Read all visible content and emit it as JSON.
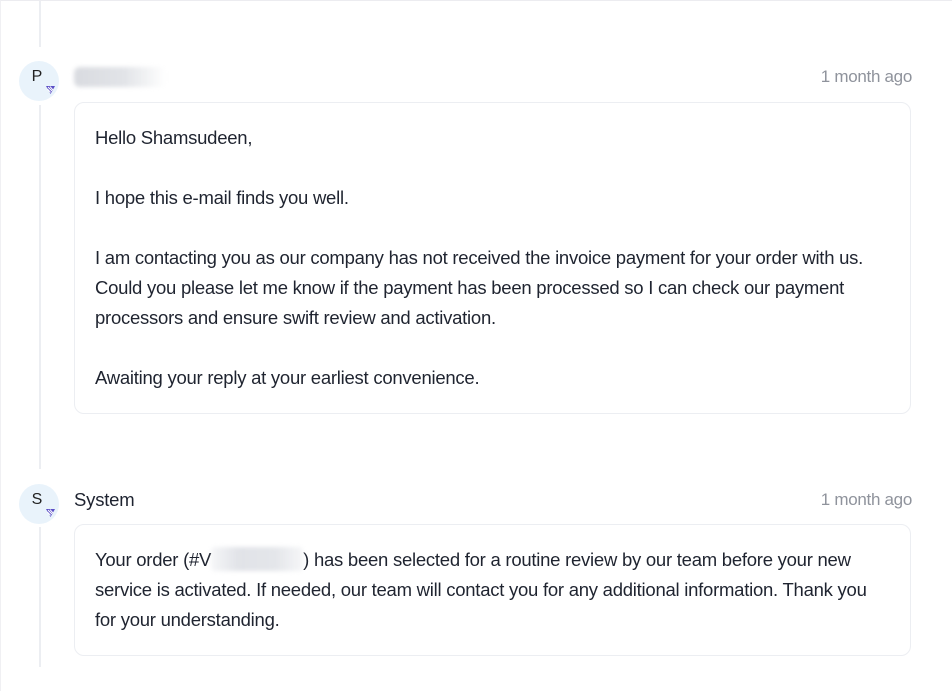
{
  "messages": [
    {
      "avatar_letter": "P",
      "sender": "",
      "time": "1 month ago",
      "paragraphs": [
        "Hello Shamsudeen,",
        "I hope this e-mail finds you well.",
        "I am contacting you as our company has not received the invoice payment for your order with us. Could you please let me know if the payment has been processed so I can check our payment processors and ensure swift review and activation.",
        "Awaiting your reply at your earliest convenience."
      ]
    },
    {
      "avatar_letter": "S",
      "sender": "System",
      "time": "1 month ago",
      "order_prefix": "Your order (#V",
      "order_suffix": ") has been selected for a routine review by our team before your new service is activated. If needed, our team will contact you for any additional information. Thank you for your understanding."
    }
  ],
  "colors": {
    "avatar_bg": "#e9f3fb",
    "badge": "#5b4fc7",
    "muted_text": "#8f939c",
    "card_border": "#eceef2"
  },
  "icons": {
    "badge": "support-badge-icon"
  }
}
